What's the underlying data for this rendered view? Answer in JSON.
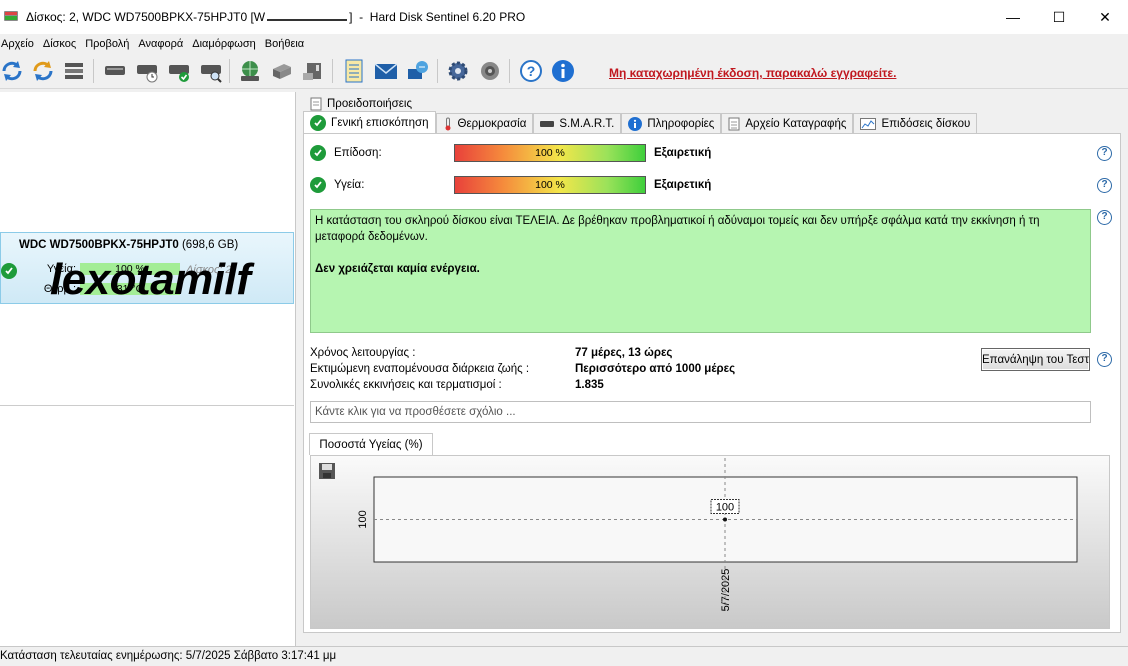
{
  "window": {
    "title_prefix": "Δίσκος: 2, WDC WD7500BPKX-75HPJT0 [W",
    "title_suffix": "]  -  Hard Disk Sentinel 6.20 PRO",
    "minimize": "—",
    "maximize": "☐",
    "close": "✕"
  },
  "menu": [
    "Αρχείο",
    "Δίσκος",
    "Προβολή",
    "Αναφορά",
    "Διαμόρφωση",
    "Βοήθεια"
  ],
  "toolbar": {
    "unregistered": "Μη καταχωρημένη έκδοση, παρακαλώ εγγραφείτε."
  },
  "disk_card": {
    "name": "WDC WD7500BPKX-75HPJT0",
    "size": "(698,6 GB)",
    "health_label": "Υγεία:",
    "health_value": "100 %",
    "temp_label": "Θερμ.:",
    "temp_value": "31 °C",
    "disk_number": "Δίσκος: 2"
  },
  "watermark": "lexotamilf",
  "tabs_top": [
    "Προειδοποιήσεις"
  ],
  "tabs": [
    "Γενική επισκόπηση",
    "Θερμοκρασία",
    "S.M.A.R.T.",
    "Πληροφορίες",
    "Αρχείο Καταγραφής",
    "Επιδόσεις δίσκου"
  ],
  "overview": {
    "performance_label": "Επίδοση:",
    "performance_value": "100 %",
    "performance_verdict": "Εξαιρετική",
    "health_label": "Υγεία:",
    "health_value": "100 %",
    "health_verdict": "Εξαιρετική",
    "status_text": "Η κατάσταση του σκληρού δίσκου είναι ΤΕΛΕΙΑ. Δε βρέθηκαν προβληματικοί ή αδύναμοι τομείς και δεν υπήρξε σφάλμα κατά την εκκίνηση ή τη μεταφορά δεδομένων.",
    "status_action": "Δεν χρειάζεται καμία ενέργεια.",
    "uptime_label": "Χρόνος λειτουργίας :",
    "uptime_value": "77 μέρες, 13 ώρες",
    "lifetime_label": "Εκτιμώμενη εναπομένουσα διάρκεια ζωής :",
    "lifetime_value": "Περισσότερο από 1000 μέρες",
    "starts_label": "Συνολικές εκκινήσεις και τερματισμοί :",
    "starts_value": "1.835",
    "repeat_test_button": "Επανάληψη του Τεστ",
    "comment_placeholder": "Κάντε κλικ για να προσθέσετε σχόλιο ..."
  },
  "chart_tab": "Ποσοστά Υγείας (%)",
  "chart_data": {
    "type": "line",
    "x": [
      "5/7/2025"
    ],
    "series": [
      {
        "values": [
          100
        ]
      }
    ],
    "data_labels": [
      "100"
    ],
    "y_tick_labels": [
      "100"
    ],
    "grid": true
  },
  "statusbar": "Κατάσταση τελευταίας ενημέρωσης: 5/7/2025 Σάββατο 3:17:41 μμ"
}
